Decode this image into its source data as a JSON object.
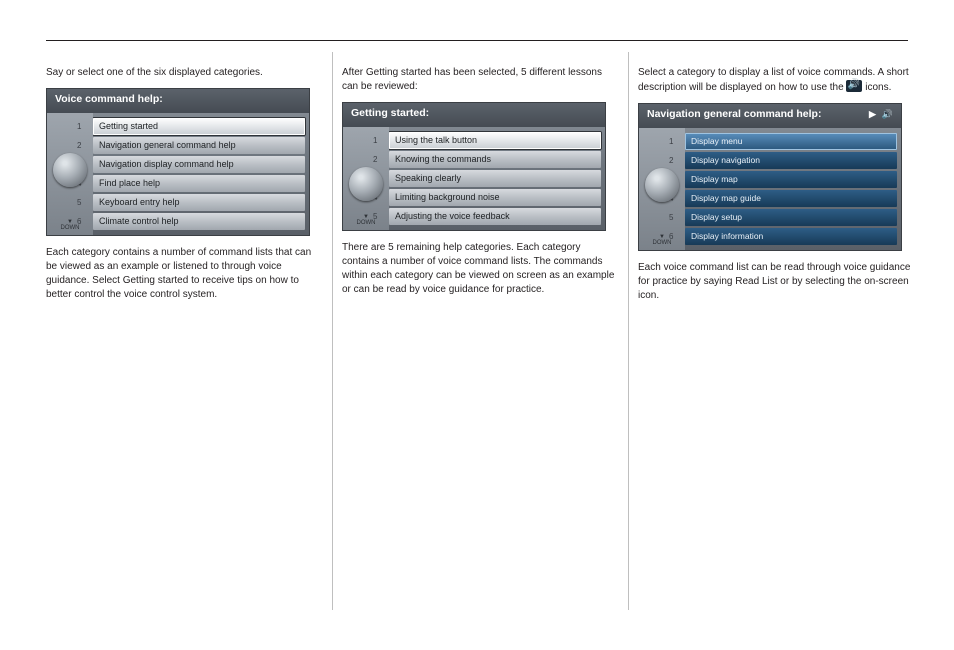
{
  "col1": {
    "p1": "Say or select one of the six displayed categories.",
    "shot": {
      "title": "Voice command help:",
      "items": [
        "Getting started",
        "Navigation general command help",
        "Navigation display command help",
        "Find place help",
        "Keyboard entry help",
        "Climate control help"
      ],
      "selected": 0,
      "nums": [
        "1",
        "2",
        "3",
        "4",
        "5",
        "6"
      ],
      "down": "▼\nDOWN"
    },
    "p2": "Each category contains a number of command lists that can be viewed as an example or listened to through voice guidance. Select Getting started to receive tips on how to better control the voice control system."
  },
  "col2": {
    "p1": "After Getting started has been selected, 5 different lessons can be reviewed:",
    "shot": {
      "title": "Getting started:",
      "items": [
        "Using the talk button",
        "Knowing the commands",
        "Speaking clearly",
        "Limiting background noise",
        "Adjusting the voice feedback"
      ],
      "selected": 0,
      "nums": [
        "1",
        "2",
        "3",
        "4",
        "5",
        ""
      ],
      "down": "▼\nDOWN"
    },
    "p2": "There are 5 remaining help categories. Each category contains a number of voice command lists. The commands within each category can be viewed on screen as an example or can be read by voice guidance for practice."
  },
  "col3": {
    "p1_pre": "Select a category to display a list of voice commands. A short description will be displayed on how to use the ",
    "p1_post": " icons.",
    "shot": {
      "title": "Navigation general command help:",
      "icons": [
        "▶",
        "🔊"
      ],
      "items": [
        "Display menu",
        "Display navigation",
        "Display map",
        "Display map guide",
        "Display setup",
        "Display information"
      ],
      "selected": 0,
      "nums": [
        "1",
        "2",
        "3",
        "4",
        "5",
        "6"
      ],
      "down": "▼\nDOWN"
    },
    "p2": "Each voice command list can be read through voice guidance for practice by saying Read List or by selecting the on-screen icon."
  }
}
